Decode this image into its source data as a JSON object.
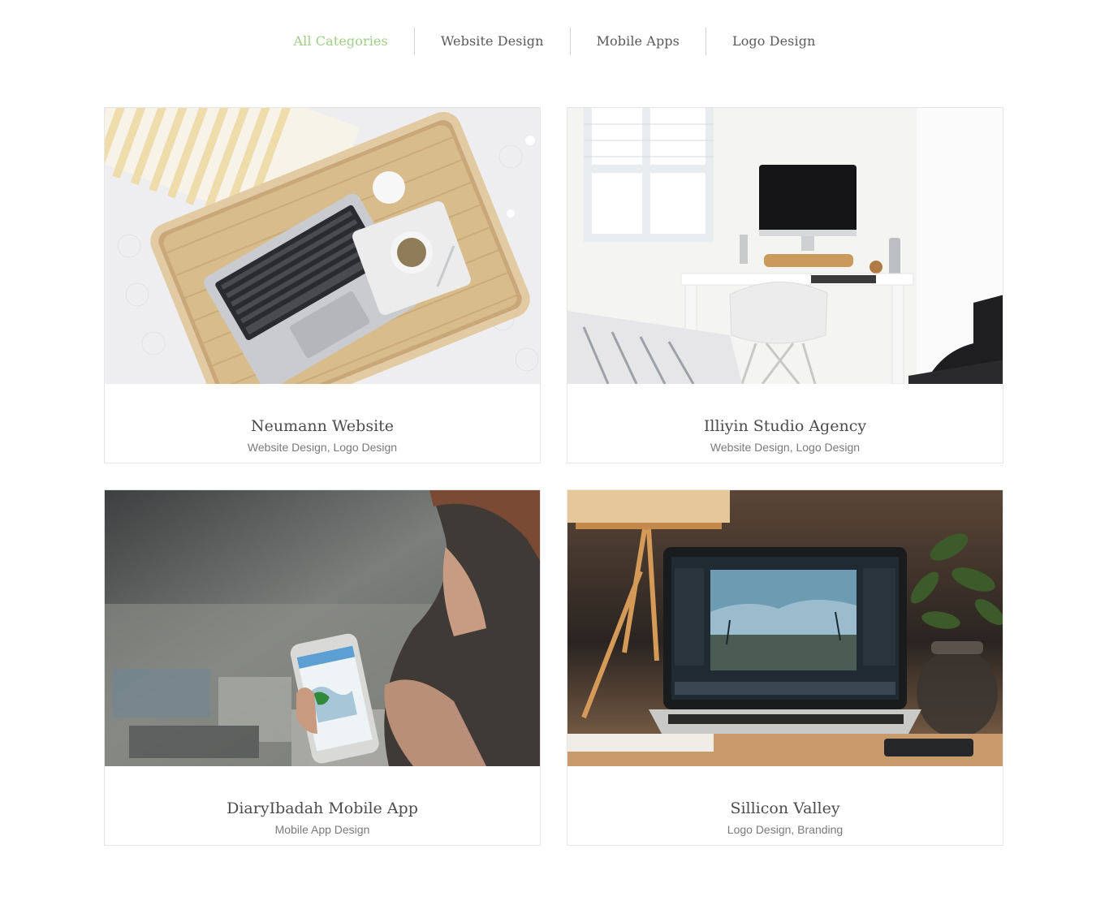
{
  "filters": [
    {
      "label": "All Categories",
      "active": true
    },
    {
      "label": "Website Design",
      "active": false
    },
    {
      "label": "Mobile Apps",
      "active": false
    },
    {
      "label": "Logo Design",
      "active": false
    }
  ],
  "colors": {
    "accent": "#9fcf85",
    "text": "#4c4c4c",
    "muted": "#7a7a7a",
    "border": "#e6e6e6"
  },
  "portfolio": {
    "items": [
      {
        "title": "Neumann Website",
        "tags": "Website Design, Logo Design",
        "image": "laptop-on-wicker-tray-photo"
      },
      {
        "title": "Illiyin Studio Agency",
        "tags": "Website Design, Logo Design",
        "image": "white-desk-workspace-photo"
      },
      {
        "title": "DiaryIbadah Mobile App",
        "tags": "Mobile App Design",
        "image": "hand-holding-phone-photo"
      },
      {
        "title": "Sillicon Valley",
        "tags": "Logo Design, Branding",
        "image": "laptop-photo-editing-photo"
      }
    ]
  }
}
